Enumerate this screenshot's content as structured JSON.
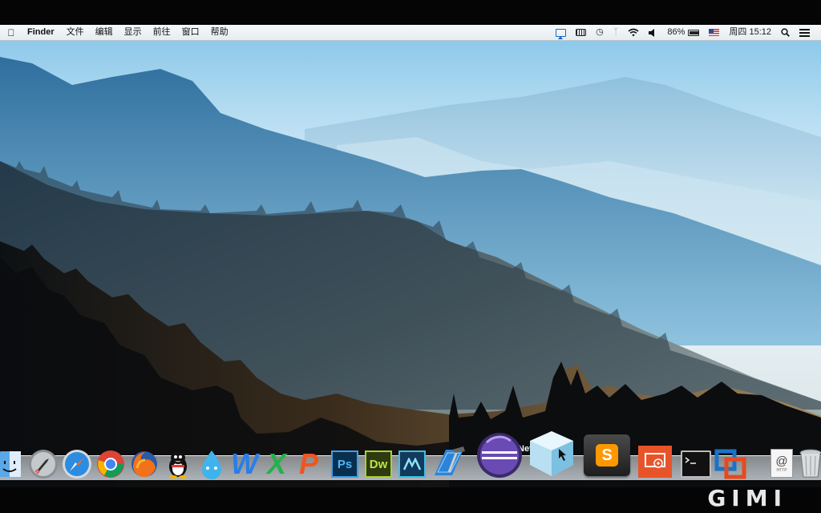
{
  "menubar": {
    "app_name": "Finder",
    "menus": [
      "文件",
      "编辑",
      "显示",
      "前往",
      "窗口",
      "帮助"
    ],
    "battery_percent": "86%",
    "day": "周四",
    "time": "15:12"
  },
  "tooltip": "NetBeans 8.0",
  "dock": {
    "items": [
      "Finder",
      "Launchpad",
      "Safari",
      "Google Chrome",
      "Firefox",
      "QQ",
      "Droplr",
      "WPS Writer",
      "WPS Spreadsheets",
      "WPS Presentation",
      "Photoshop",
      "Dreamweaver",
      "Muse",
      "Xcode",
      "Eclipse",
      "NetBeans 8.0",
      "Sublime Text",
      "Remote Desktop",
      "Terminal",
      "VMware Fusion",
      "Web Address",
      "Trash"
    ],
    "glyphs": {
      "ps": "Ps",
      "dw": "Dw",
      "sublime": "S",
      "wps_w": "W",
      "wps_x": "X",
      "wps_p": "P",
      "web": "@",
      "http": "HTTP"
    }
  },
  "watermark": "GIMI",
  "colors": {
    "menubar_bg": "#eef3f6",
    "photoshop": "#0a2f4e",
    "dreamweaver": "#2f3a10",
    "sublime": "#ff9800",
    "remote_desktop": "#e8542a"
  },
  "icons": {
    "apple": "apple-logo-icon",
    "airplay": "airplay-icon",
    "battery": "battery-icon",
    "wifi": "wifi-icon",
    "volume": "volume-icon",
    "bluetooth": "bluetooth-icon",
    "time_machine": "time-machine-icon",
    "flag": "us-flag-icon",
    "notification": "notification-center-icon"
  }
}
